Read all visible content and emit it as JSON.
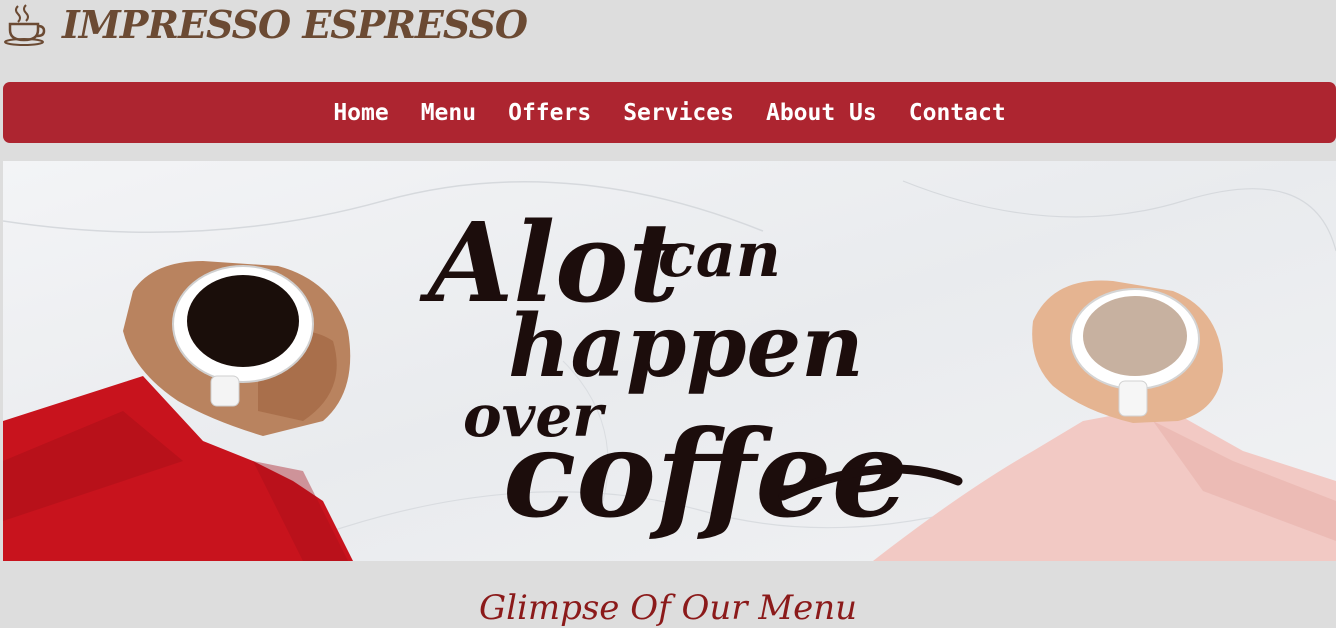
{
  "brand": {
    "name": "IMPRESSO ESPRESSO",
    "icon": "coffee-cup-icon",
    "color": "#6b4a33"
  },
  "nav": {
    "background": "#ad2530",
    "items": [
      {
        "label": "Home"
      },
      {
        "label": "Menu"
      },
      {
        "label": "Offers"
      },
      {
        "label": "Services"
      },
      {
        "label": "About Us"
      },
      {
        "label": "Contact"
      }
    ]
  },
  "hero": {
    "line1a": "Alot",
    "line1b": "can",
    "line2": "happen",
    "line3": "over",
    "line4": "coffee"
  },
  "section": {
    "title": "Glimpse Of Our Menu"
  }
}
